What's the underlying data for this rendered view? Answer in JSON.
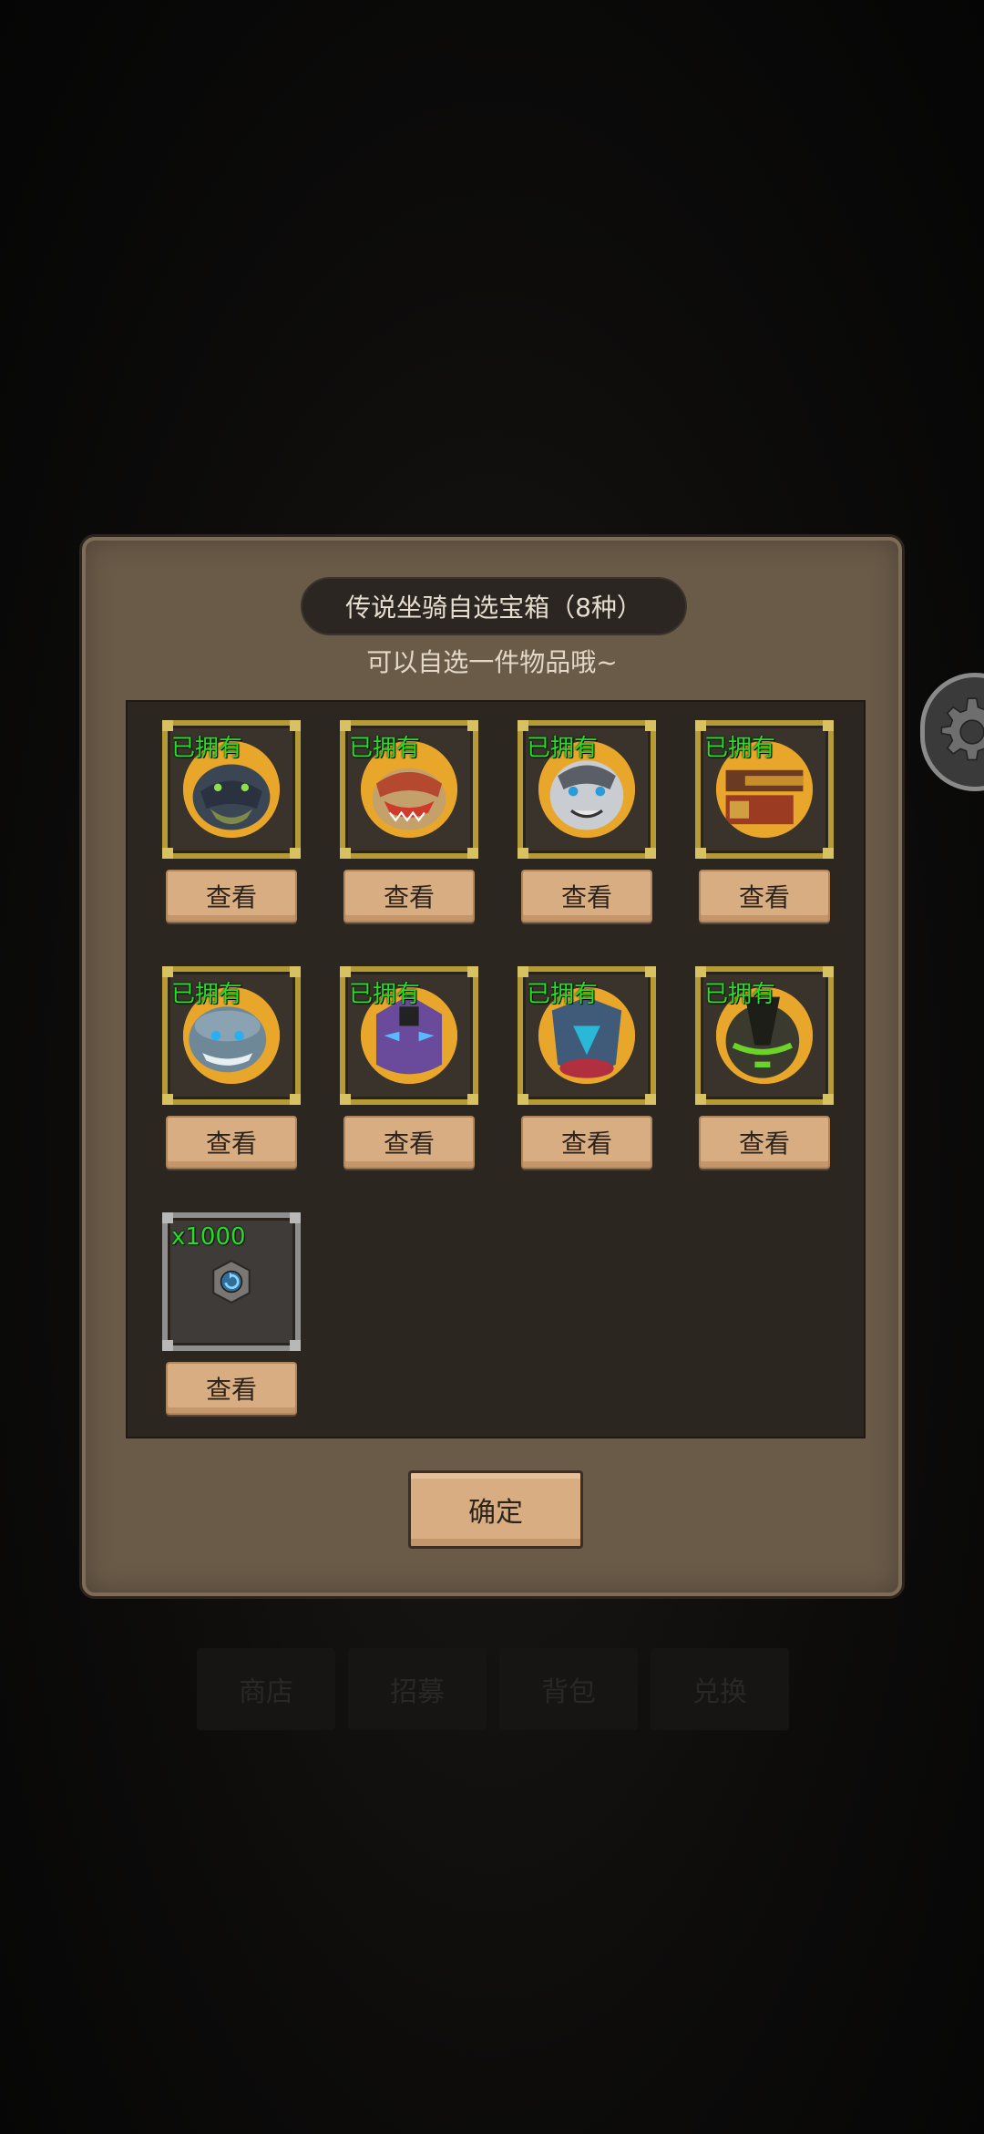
{
  "dialog": {
    "title": "传说坐骑自选宝箱（8种）",
    "subtitle": "可以自选一件物品哦~",
    "confirm_label": "确定"
  },
  "items": [
    {
      "badge": "已拥有",
      "view_label": "查看",
      "portrait": "dark-crocodile-mount-icon",
      "color": "#3b4655"
    },
    {
      "badge": "已拥有",
      "view_label": "查看",
      "portrait": "red-armored-dino-mount-icon",
      "color": "#b5492f"
    },
    {
      "badge": "已拥有",
      "view_label": "查看",
      "portrait": "white-tiger-mount-icon",
      "color": "#c9ccd0"
    },
    {
      "badge": "已拥有",
      "view_label": "查看",
      "portrait": "mechanical-beast-mount-icon",
      "color": "#9b3b22"
    },
    {
      "badge": "已拥有",
      "view_label": "查看",
      "portrait": "blue-shark-mount-icon",
      "color": "#6f8898"
    },
    {
      "badge": "已拥有",
      "view_label": "查看",
      "portrait": "purple-dragon-mount-icon",
      "color": "#6a4a9a"
    },
    {
      "badge": "已拥有",
      "view_label": "查看",
      "portrait": "armored-steed-mount-icon",
      "color": "#405a7a"
    },
    {
      "badge": "已拥有",
      "view_label": "查看",
      "portrait": "green-armor-mount-icon",
      "color": "#3a3a2e"
    }
  ],
  "extra_item": {
    "quantity": "x1000",
    "view_label": "查看",
    "icon": "hexagon-token-icon"
  },
  "background": {
    "tabs": [
      "商店",
      "招募",
      "背包",
      "兑换"
    ]
  }
}
